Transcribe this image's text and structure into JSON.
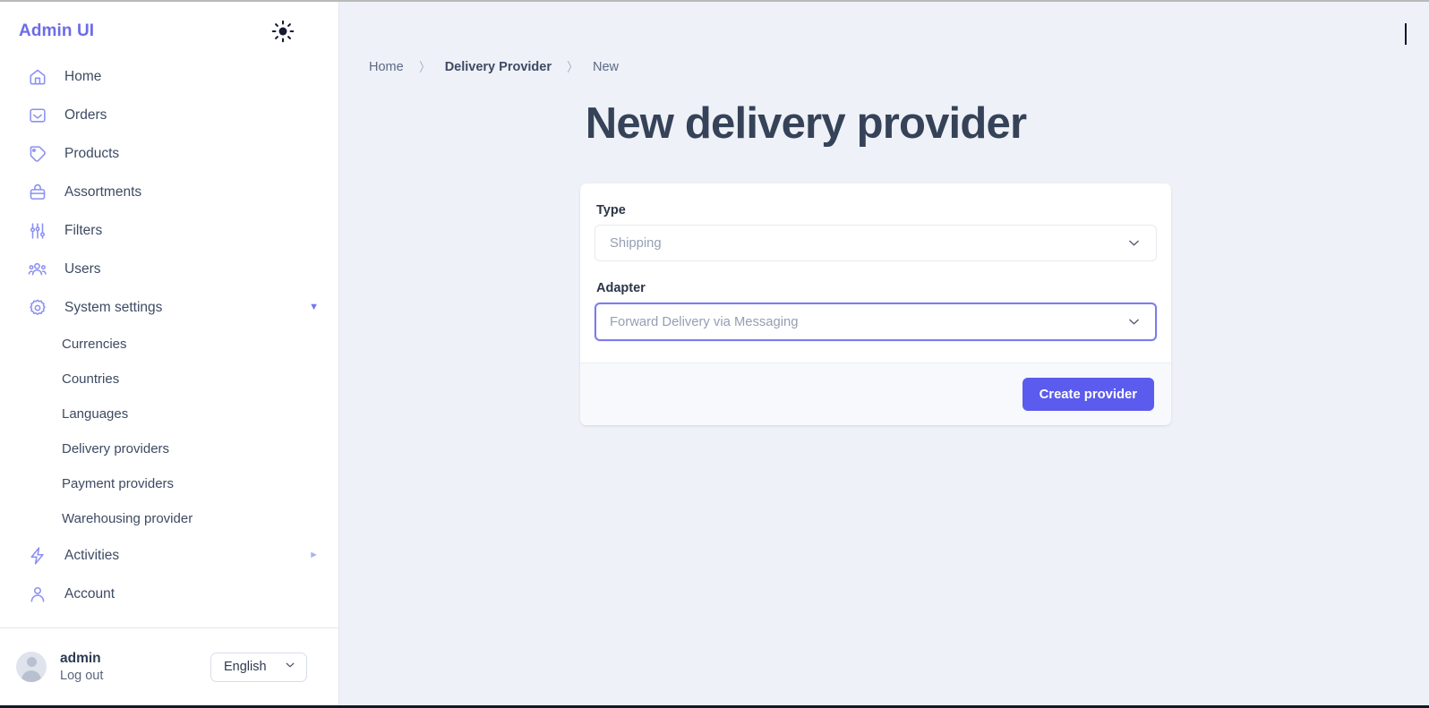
{
  "app": {
    "brand": "Admin UI",
    "theme_toggle_icon": "sun-icon"
  },
  "sidebar": {
    "items": [
      {
        "label": "Home",
        "icon": "home-icon"
      },
      {
        "label": "Orders",
        "icon": "inbox-icon"
      },
      {
        "label": "Products",
        "icon": "tag-icon"
      },
      {
        "label": "Assortments",
        "icon": "basket-icon"
      },
      {
        "label": "Filters",
        "icon": "sliders-icon"
      },
      {
        "label": "Users",
        "icon": "users-icon"
      },
      {
        "label": "System settings",
        "icon": "gear-icon",
        "caret": "▼",
        "expanded": true
      },
      {
        "label": "Activities",
        "icon": "bolt-icon",
        "caret": "►",
        "expanded": false
      },
      {
        "label": "Account",
        "icon": "person-icon"
      }
    ],
    "system_settings_children": [
      {
        "label": "Currencies"
      },
      {
        "label": "Countries"
      },
      {
        "label": "Languages"
      },
      {
        "label": "Delivery providers"
      },
      {
        "label": "Payment providers"
      },
      {
        "label": "Warehousing provider"
      }
    ],
    "user": {
      "name": "admin",
      "logout_label": "Log out",
      "language_value": "English",
      "avatar_icon": "avatar-icon"
    }
  },
  "breadcrumb": [
    {
      "label": "Home"
    },
    {
      "label": "Delivery Provider"
    },
    {
      "label": "New"
    }
  ],
  "breadcrumb_separator": "〉",
  "main": {
    "page_title": "New delivery provider",
    "form": {
      "type": {
        "label": "Type",
        "value": "Shipping",
        "chevron_icon": "chevron-down-icon"
      },
      "adapter": {
        "label": "Adapter",
        "value": "Forward Delivery via Messaging",
        "chevron_icon": "chevron-down-icon",
        "focused": true
      },
      "submit_label": "Create provider"
    }
  },
  "colors": {
    "brand": "#6c6ce8",
    "accent": "#5b5bee",
    "focus_border": "#7c7cf0",
    "page_bg": "#eef1f7",
    "sidebar_bg": "#ffffff",
    "text": "#3d4a63",
    "title": "#354258"
  }
}
